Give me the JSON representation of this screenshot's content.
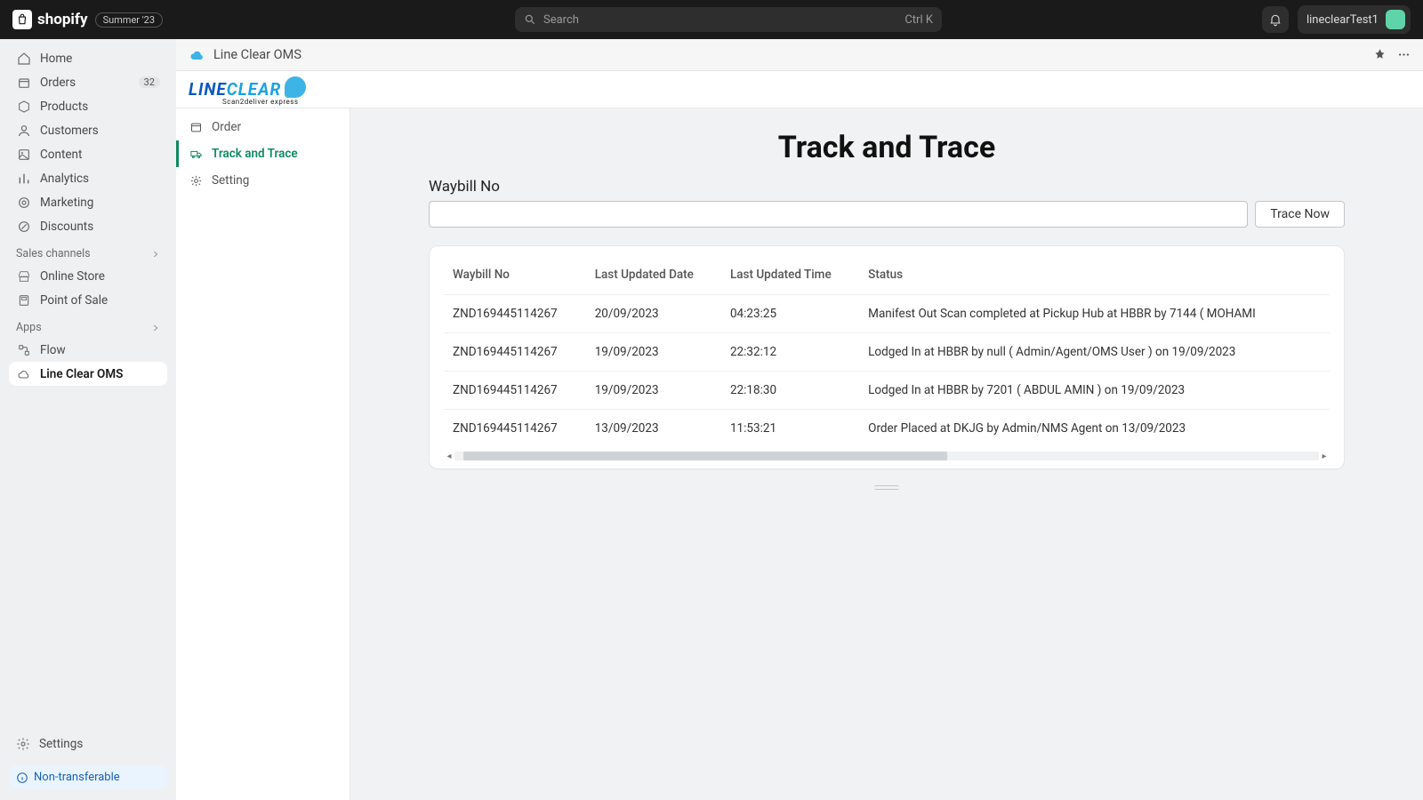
{
  "topbar": {
    "brand": "shopify",
    "badge_label": "Summer '23",
    "search_placeholder": "Search",
    "search_shortcut": "Ctrl K",
    "username": "lineclearTest1"
  },
  "nav": {
    "items": [
      {
        "label": "Home",
        "icon": "home"
      },
      {
        "label": "Orders",
        "icon": "orders",
        "badge": "32"
      },
      {
        "label": "Products",
        "icon": "products"
      },
      {
        "label": "Customers",
        "icon": "customers"
      },
      {
        "label": "Content",
        "icon": "content"
      },
      {
        "label": "Analytics",
        "icon": "analytics"
      },
      {
        "label": "Marketing",
        "icon": "marketing"
      },
      {
        "label": "Discounts",
        "icon": "discounts"
      }
    ],
    "channels_label": "Sales channels",
    "channels": [
      {
        "label": "Online Store",
        "icon": "store"
      },
      {
        "label": "Point of Sale",
        "icon": "pos"
      }
    ],
    "apps_label": "Apps",
    "apps": [
      {
        "label": "Flow",
        "icon": "flow"
      },
      {
        "label": "Line Clear OMS",
        "icon": "cloud",
        "active": true
      }
    ],
    "settings_label": "Settings",
    "footer_label": "Non-transferable"
  },
  "app": {
    "title": "Line Clear OMS",
    "brand_main": "LINE",
    "brand_secondary": "CLEAR",
    "brand_sub": "Scan2deliver express",
    "side": [
      {
        "label": "Order",
        "icon": "order"
      },
      {
        "label": "Track and Trace",
        "icon": "truck",
        "active": true
      },
      {
        "label": "Setting",
        "icon": "gear"
      }
    ],
    "page_title": "Track and Trace",
    "field_label": "Waybill No",
    "trace_button": "Trace Now",
    "columns": [
      "Waybill No",
      "Last Updated Date",
      "Last Updated Time",
      "Status"
    ],
    "rows": [
      {
        "waybill": "ZND169445114267",
        "date": "20/09/2023",
        "time": "04:23:25",
        "status": "Manifest Out Scan completed at Pickup Hub at HBBR by 7144 ( MOHAMI"
      },
      {
        "waybill": "ZND169445114267",
        "date": "19/09/2023",
        "time": "22:32:12",
        "status": "Lodged In at HBBR by null ( Admin/Agent/OMS User ) on 19/09/2023"
      },
      {
        "waybill": "ZND169445114267",
        "date": "19/09/2023",
        "time": "22:18:30",
        "status": "Lodged In at HBBR by 7201 ( ABDUL AMIN ) on 19/09/2023"
      },
      {
        "waybill": "ZND169445114267",
        "date": "13/09/2023",
        "time": "11:53:21",
        "status": "Order Placed at DKJG by Admin/NMS Agent on 13/09/2023"
      }
    ]
  }
}
